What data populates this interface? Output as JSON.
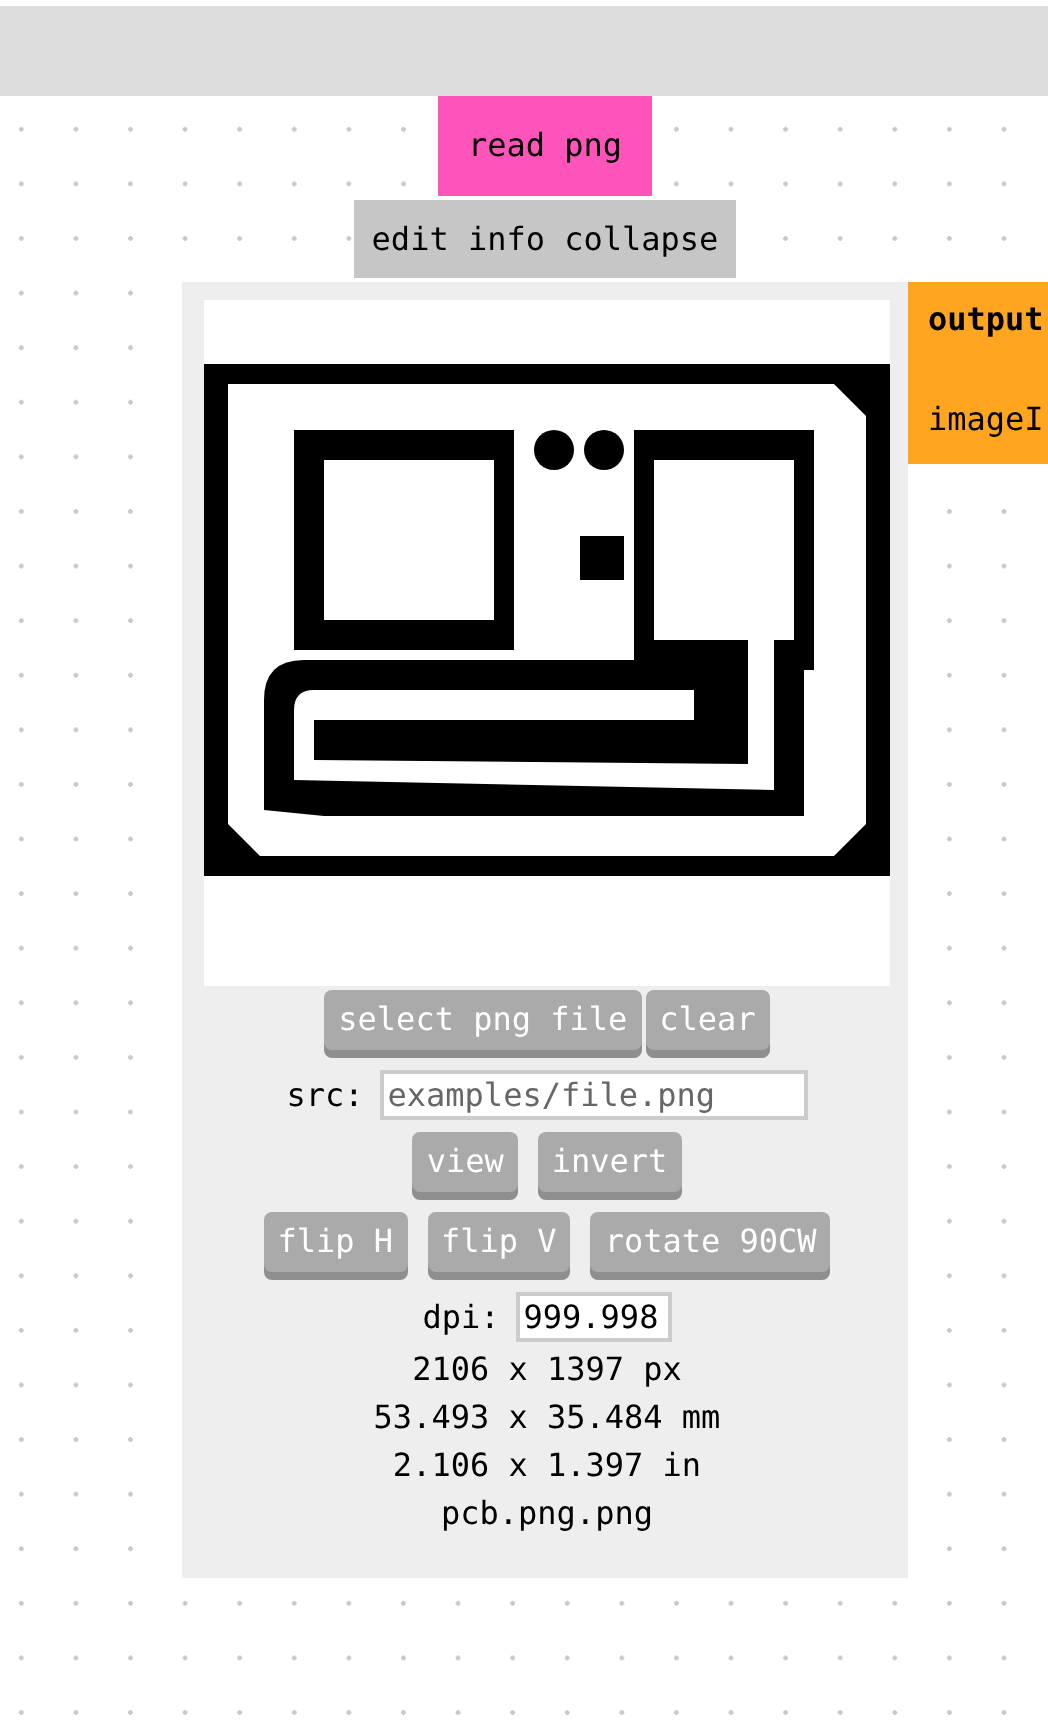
{
  "module": {
    "title": "read png",
    "menu": "edit info collapse",
    "image": {
      "kind": "picture"
    },
    "button_rows": [
      [
        "select png file",
        "clear"
      ],
      [
        "view",
        "invert"
      ],
      [
        "flip H",
        "flip V",
        "rotate 90CW"
      ]
    ],
    "src": {
      "label": "src:",
      "placeholder": "examples/file.png"
    },
    "dpi": {
      "label": "dpi:",
      "value": "999.998"
    },
    "info": [
      "2106 x 1397 px",
      "53.493 x 35.484 mm",
      "2.106 x 1.397 in",
      "pcb.png.png"
    ]
  },
  "output": {
    "title": "output",
    "items": [
      "imageI"
    ]
  }
}
